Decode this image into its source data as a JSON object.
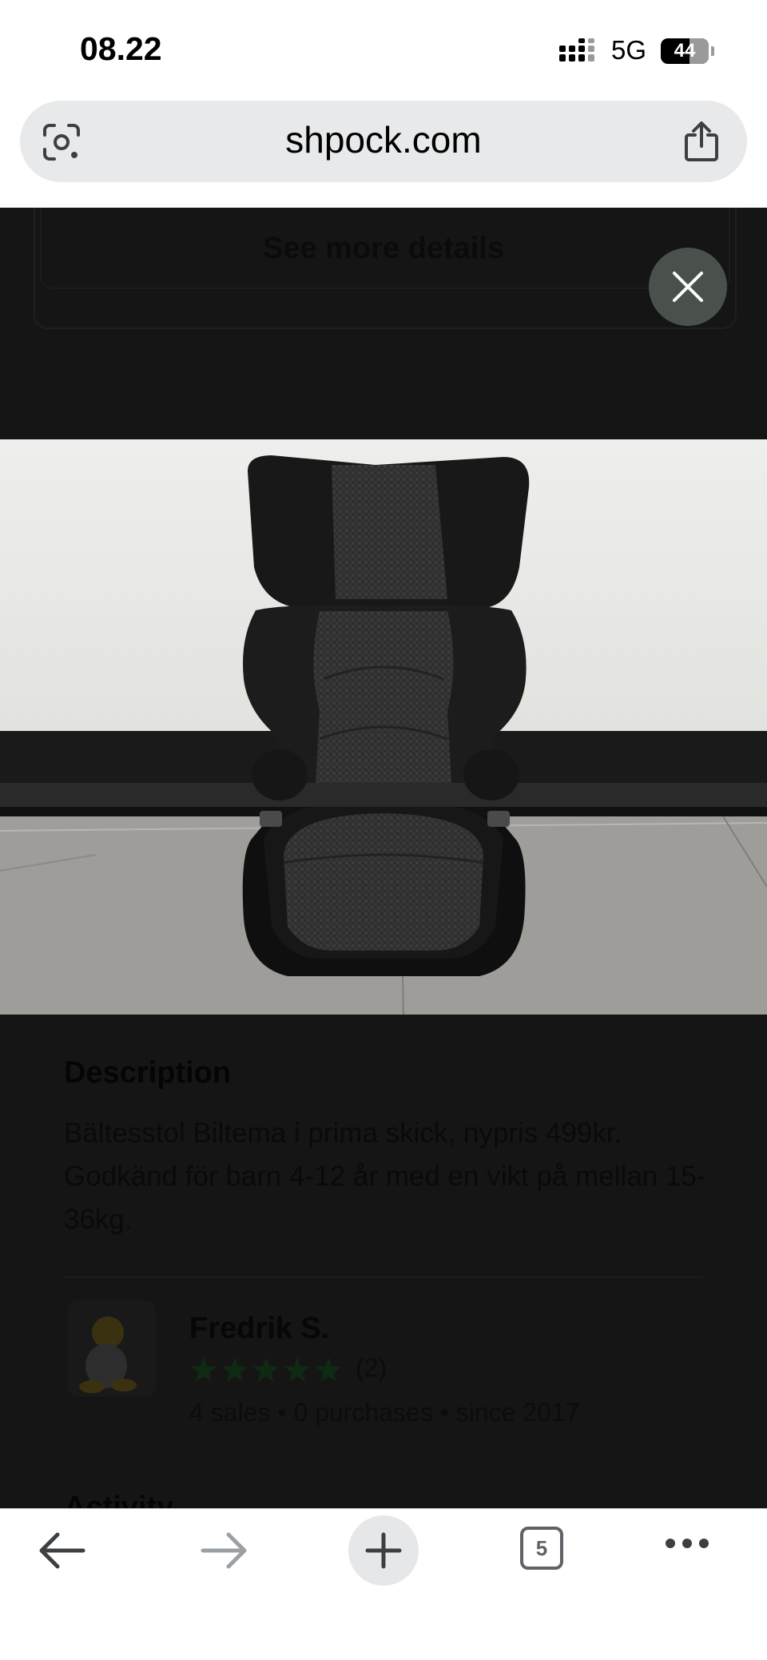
{
  "status_bar": {
    "time": "08.22",
    "network": "5G",
    "battery": "44"
  },
  "browser": {
    "url": "shpock.com",
    "open_tabs": "5"
  },
  "listing": {
    "details_button_label": "See more details",
    "description_title": "Description",
    "description_text": "Bältesstol Biltema i prima skick, nypris 499kr. Godkänd för barn 4-12 år med en vikt på mellan 15-36kg.",
    "activity_title": "Activity"
  },
  "seller": {
    "name": "Fredrik S.",
    "rating_stars": 5,
    "rating_count": "(2)",
    "stats": "4 sales • 0 purchases • since 2017"
  },
  "colors": {
    "overlay_bg": "#151515",
    "star_color": "#0e2a12",
    "close_button_bg": "#4a514c",
    "toolbar_icon": "#5f6368"
  },
  "icons": [
    "signal-icon",
    "battery-icon",
    "lens-icon",
    "share-icon",
    "close-icon",
    "back-icon",
    "forward-icon",
    "plus-icon",
    "tabs-icon",
    "more-icon",
    "star-icon"
  ]
}
